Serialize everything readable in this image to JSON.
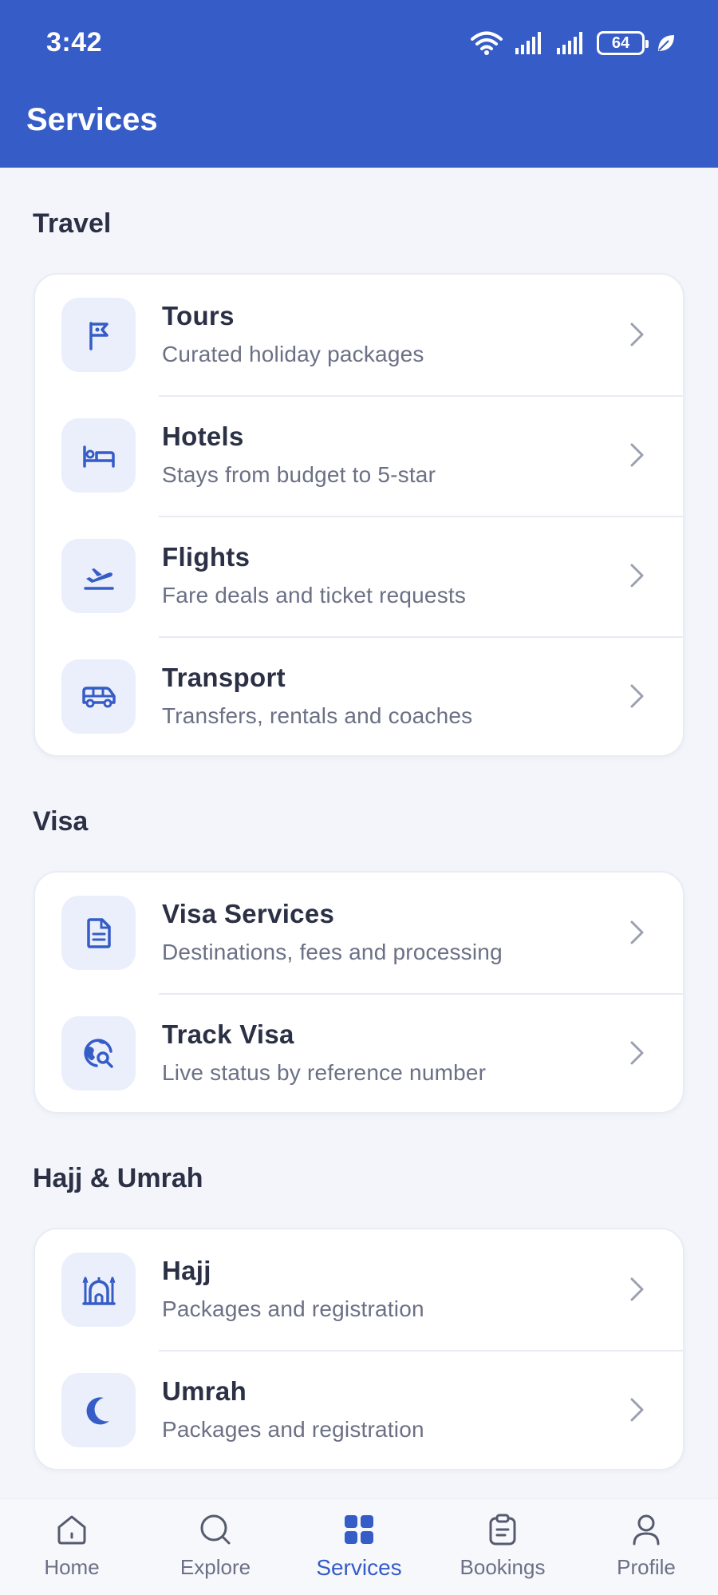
{
  "status_bar": {
    "time": "3:42",
    "battery": "64"
  },
  "header": {
    "title": "Services"
  },
  "sections": [
    {
      "title": "Travel",
      "items": [
        {
          "title": "Tours",
          "subtitle": "Curated holiday packages",
          "icon": "flag-icon"
        },
        {
          "title": "Hotels",
          "subtitle": "Stays from budget to 5-star",
          "icon": "bed-icon"
        },
        {
          "title": "Flights",
          "subtitle": "Fare deals and ticket requests",
          "icon": "plane-takeoff-icon"
        },
        {
          "title": "Transport",
          "subtitle": "Transfers, rentals and coaches",
          "icon": "van-icon"
        }
      ]
    },
    {
      "title": "Visa",
      "items": [
        {
          "title": "Visa Services",
          "subtitle": "Destinations, fees and processing",
          "icon": "document-icon"
        },
        {
          "title": "Track Visa",
          "subtitle": "Live status by reference number",
          "icon": "globe-search-icon"
        }
      ]
    },
    {
      "title": "Hajj & Umrah",
      "items": [
        {
          "title": "Hajj",
          "subtitle": "Packages and registration",
          "icon": "mosque-icon"
        },
        {
          "title": "Umrah",
          "subtitle": "Packages and registration",
          "icon": "crescent-moon-icon"
        }
      ]
    }
  ],
  "bottom_nav": {
    "items": [
      {
        "label": "Home",
        "icon": "home-icon"
      },
      {
        "label": "Explore",
        "icon": "search-icon"
      },
      {
        "label": "Services",
        "icon": "grid-icon",
        "active": true
      },
      {
        "label": "Bookings",
        "icon": "clipboard-icon"
      },
      {
        "label": "Profile",
        "icon": "user-icon"
      }
    ]
  },
  "colors": {
    "primary": "#355cc7",
    "background": "#f3f5fa",
    "card": "#ffffff",
    "icon_tile": "#eaeffb",
    "text_primary": "#2b3045",
    "text_secondary": "#6b7085",
    "chevron": "#9aa0ae"
  }
}
